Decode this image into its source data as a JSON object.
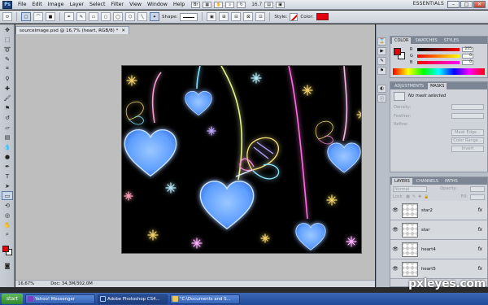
{
  "menubar": {
    "logo": "Ps",
    "items": [
      "File",
      "Edit",
      "Image",
      "Layer",
      "Select",
      "Filter",
      "View",
      "Window",
      "Help"
    ],
    "zoom": "16.7",
    "workspace": "ESSENTIALS"
  },
  "options": {
    "shape_label": "Shape:",
    "style_label": "Style:",
    "color_label": "Color:",
    "color": "#e3000f"
  },
  "document": {
    "tab_title": "sourceimage.psd @ 16,7% (heart, RGB/8) *",
    "zoom_status": "16,67%",
    "doc_status": "Doc: 34,3M/302,0M"
  },
  "color_panel": {
    "tabs": [
      "COLOR",
      "SWATCHES",
      "STYLES"
    ],
    "r_label": "R",
    "g_label": "G",
    "b_label": "B",
    "r": "255",
    "g": "0",
    "b": "0"
  },
  "masks_panel": {
    "tabs": [
      "ADJUSTMENTS",
      "MASKS"
    ],
    "status": "No mask selected",
    "density_label": "Density:",
    "feather_label": "Feather:",
    "refine_label": "Refine:",
    "mask_edge": "Mask Edge...",
    "color_range": "Color Range...",
    "invert": "Invert"
  },
  "layers_panel": {
    "tabs": [
      "LAYERS",
      "CHANNELS",
      "PATHS"
    ],
    "blend_mode": "Normal",
    "opacity_label": "Opacity:",
    "lock_label": "Lock:",
    "fill_label": "Fill:",
    "layers": [
      {
        "name": "star2",
        "fx": "fx"
      },
      {
        "name": "star",
        "fx": "fx"
      },
      {
        "name": "heart4",
        "fx": "fx"
      },
      {
        "name": "heart5",
        "fx": "fx"
      }
    ]
  },
  "taskbar": {
    "start": "start",
    "tasks": [
      "Yahoo! Messenger",
      "Adobe Photoshop CS4...",
      "\"C:\\Documents and S..."
    ]
  },
  "watermark": "pxleyes.com"
}
